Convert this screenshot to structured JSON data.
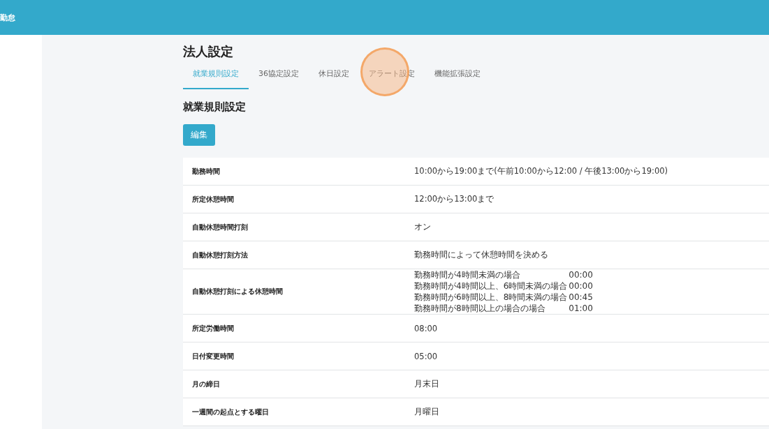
{
  "header": {
    "title": "勤怠"
  },
  "page_title": "法人設定",
  "tabs": [
    {
      "label": "就業規則設定",
      "selected": true
    },
    {
      "label": "36協定設定",
      "selected": false
    },
    {
      "label": "休日設定",
      "selected": false
    },
    {
      "label": "アラート設定",
      "selected": false
    },
    {
      "label": "機能拡張設定",
      "selected": false
    }
  ],
  "click_marker": {
    "on": true
  },
  "section_title": "就業規則設定",
  "edit_button": "編集",
  "settings": [
    {
      "label": "勤務時間",
      "value": "10:00から19:00まで(午前10:00から12:00 / 午後13:00から19:00)"
    },
    {
      "label": "所定休憩時間",
      "value": "12:00から13:00まで"
    },
    {
      "label": "自動休憩時間打刻",
      "value": "オン"
    },
    {
      "label": "自動休憩打刻方法",
      "value": "勤務時間によって休憩時間を決める"
    },
    {
      "label": "自動休憩打刻による休憩時間",
      "breaks": [
        {
          "condition": "勤務時間が4時間未満の場合",
          "time": "00:00"
        },
        {
          "condition": "勤務時間が4時間以上、6時間未満の場合",
          "time": "00:00"
        },
        {
          "condition": "勤務時間が6時間以上、8時間未満の場合",
          "time": "00:45"
        },
        {
          "condition": "勤務時間が8時間以上の場合の場合",
          "time": "01:00"
        }
      ]
    },
    {
      "label": "所定労働時間",
      "value": "08:00"
    },
    {
      "label": "日付変更時間",
      "value": "05:00"
    },
    {
      "label": "月の締日",
      "value": "月末日"
    },
    {
      "label": "一週間の起点とする曜日",
      "value": "月曜日"
    }
  ]
}
